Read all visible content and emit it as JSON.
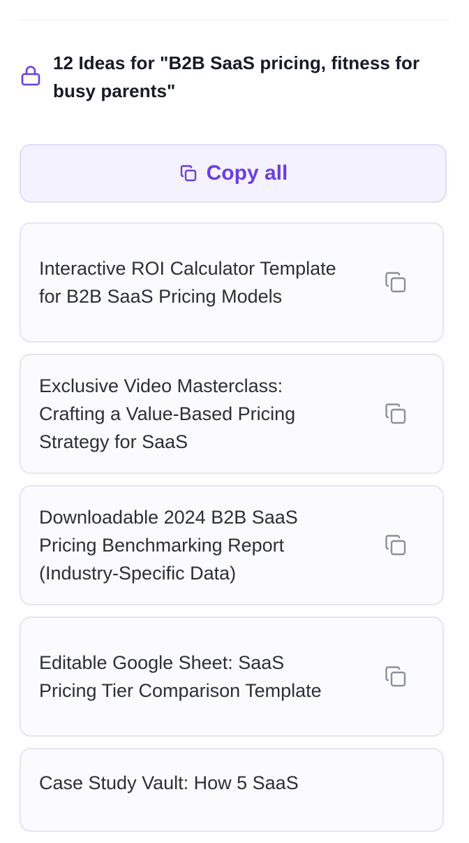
{
  "header": {
    "title": "12 Ideas for \"B2B SaaS pricing, fitness for busy parents\"",
    "icon": "lock-icon"
  },
  "copy_all": {
    "label": "Copy all",
    "icon": "copy-icon"
  },
  "ideas": [
    {
      "text": "Interactive ROI Calculator Template for B2B SaaS Pricing Models",
      "icon": "copy-icon"
    },
    {
      "text": "Exclusive Video Masterclass: Crafting a Value-Based Pricing Strategy for SaaS",
      "icon": "copy-icon"
    },
    {
      "text": "Downloadable 2024 B2B SaaS Pricing Benchmarking Report (Industry-Specific Data)",
      "icon": "copy-icon"
    },
    {
      "text": "Editable Google Sheet: SaaS Pricing Tier Comparison Template",
      "icon": "copy-icon"
    },
    {
      "text": "Case Study Vault: How 5 SaaS",
      "icon": "copy-icon"
    }
  ],
  "colors": {
    "accent": "#6a3fe0",
    "card_border": "#e6e4f4",
    "icon_gray": "#8a8f99"
  }
}
